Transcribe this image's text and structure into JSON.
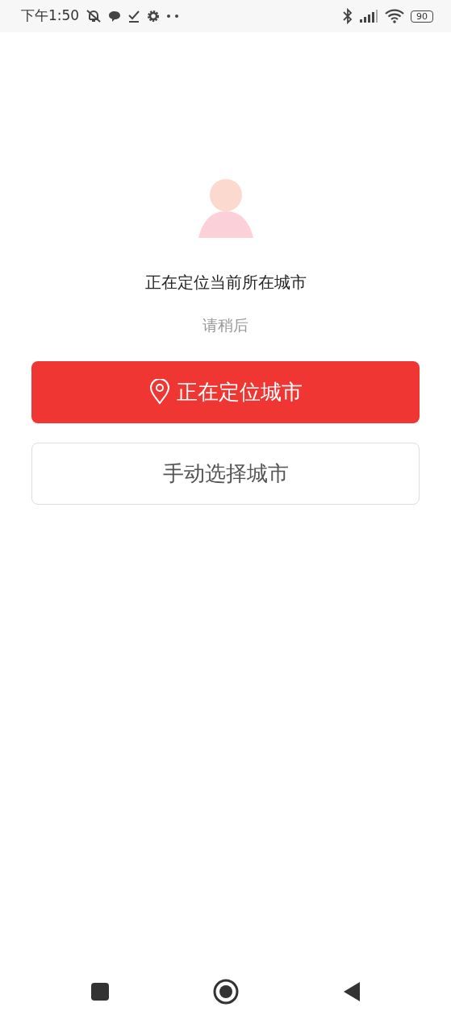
{
  "status_bar": {
    "time": "下午1:50",
    "battery": "90"
  },
  "title": "正在定位当前所在城市",
  "subtitle": "请稍后",
  "buttons": [
    {
      "kind": "primary",
      "label": "正在定位城市"
    },
    {
      "kind": "outline",
      "label": "手动选择城市"
    }
  ]
}
